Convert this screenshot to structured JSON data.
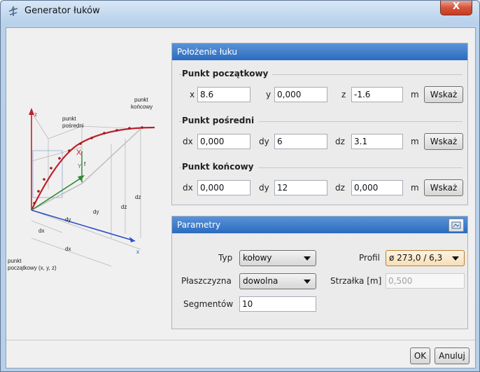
{
  "window": {
    "title": "Generator łuków",
    "close_label": "X"
  },
  "illustration": {
    "z_axis": "z",
    "x_axis": "x",
    "y_axis": "Y",
    "end_point_label_1": "punkt",
    "end_point_label_2": "końcowy",
    "mid_point_label_1": "punkt",
    "mid_point_label_2": "pośredni",
    "start_point_label_1": "punkt",
    "start_point_label_2": "początkowy (x, y, z)",
    "f_label": "f",
    "x_marker": "X",
    "dz": "dz",
    "dy": "dy",
    "dx": "dx"
  },
  "position_group": {
    "title": "Położenie łuku",
    "start": {
      "title": "Punkt początkowy",
      "x_label": "x",
      "x_value": "8.6",
      "y_label": "y",
      "y_value": "0,000",
      "z_label": "z",
      "z_value": "-1.6",
      "unit": "m",
      "button": "Wskaż"
    },
    "mid": {
      "title": "Punkt pośredni",
      "x_label": "dx",
      "x_value": "0,000",
      "y_label": "dy",
      "y_value": "6",
      "z_label": "dz",
      "z_value": "3.1",
      "unit": "m",
      "button": "Wskaż"
    },
    "end": {
      "title": "Punkt końcowy",
      "x_label": "dx",
      "x_value": "0,000",
      "y_label": "dy",
      "y_value": "12",
      "z_label": "dz",
      "z_value": "0,000",
      "unit": "m",
      "button": "Wskaż"
    }
  },
  "params_group": {
    "title": "Parametry",
    "type_label": "Typ",
    "type_value": "kołowy",
    "plane_label": "Płaszczyzna",
    "plane_value": "dowolna",
    "segments_label": "Segmentów",
    "segments_value": "10",
    "profile_label": "Profil",
    "profile_value": "ø 273,0 / 6,3",
    "sagitta_label": "Strzałka [m]",
    "sagitta_value": "0,500"
  },
  "footer": {
    "ok": "OK",
    "cancel": "Anuluj"
  },
  "colors": {
    "header_blue": "#2b6bc0",
    "arc_red": "#c0202a",
    "axis_blue": "#2d4fc7",
    "axis_green": "#2d8a2d"
  }
}
